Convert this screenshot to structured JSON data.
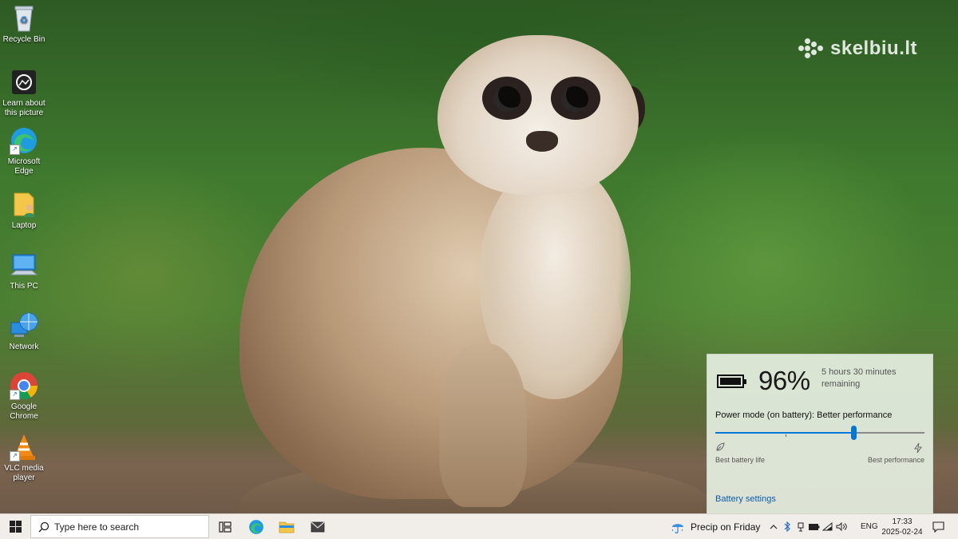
{
  "desktop": {
    "icons": [
      {
        "label": "Recycle Bin",
        "icon": "recycle-bin-icon"
      },
      {
        "label": "Learn about this picture",
        "icon": "camera-icon"
      },
      {
        "label": "Microsoft Edge",
        "icon": "edge-icon"
      },
      {
        "label": "Laptop",
        "icon": "folder-user-icon"
      },
      {
        "label": "This PC",
        "icon": "computer-icon"
      },
      {
        "label": "Network",
        "icon": "network-icon"
      },
      {
        "label": "Google Chrome",
        "icon": "chrome-icon"
      },
      {
        "label": "VLC media player",
        "icon": "vlc-icon"
      }
    ],
    "watermark": "skelbiu.lt"
  },
  "battery_flyout": {
    "percent": "96%",
    "remaining": "5 hours 30 minutes remaining",
    "power_mode": "Power mode (on battery): Better performance",
    "slider_value": 0.66,
    "left_label": "Best battery life",
    "right_label": "Best performance",
    "settings_link": "Battery settings"
  },
  "taskbar": {
    "search_placeholder": "Type here to search",
    "weather": "Precip on Friday",
    "language": "ENG",
    "time": "17:33",
    "date": "2025-02-24",
    "pinned": [
      "task-view-icon",
      "edge-icon",
      "file-explorer-icon",
      "mail-icon"
    ]
  },
  "colors": {
    "accent": "#0078d4",
    "link": "#0b5cad",
    "taskbar_bg": "#f1eee9",
    "flyout_bg": "#e2ecde"
  }
}
